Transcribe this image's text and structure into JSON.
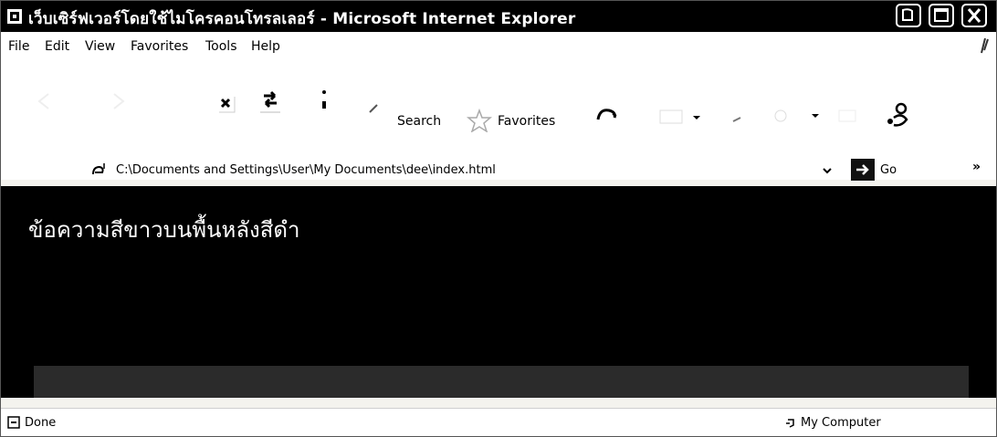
{
  "window": {
    "title": "เว็บเซิร์ฟเวอร์โดยใช้ไมโครคอนโทรลเลอร์ - Microsoft Internet Explorer"
  },
  "menubar": {
    "items": [
      "File",
      "Edit",
      "View",
      "Favorites",
      "Tools",
      "Help"
    ]
  },
  "toolbar": {
    "search_label": "Search",
    "favorites_label": "Favorites"
  },
  "address": {
    "url": "C:\\Documents and Settings\\User\\My Documents\\dee\\index.html",
    "go_label": "Go",
    "more_glyph": "»"
  },
  "content": {
    "text": "ข้อความสีขาวบนพื้นหลังสีดำ",
    "background": "#000000",
    "text_color": "#ffffff"
  },
  "statusbar": {
    "status": "Done",
    "zone": "My Computer"
  },
  "colors": {
    "titlebar": "#000000",
    "chrome": "#ffffff"
  },
  "icons": [
    "ie-icon",
    "minimize-icon",
    "maximize-icon",
    "close-icon",
    "throbber-icon",
    "back-icon",
    "forward-icon",
    "stop-icon",
    "refresh-icon",
    "home-icon",
    "search-icon",
    "favorites-icon",
    "history-icon",
    "mail-icon",
    "print-icon",
    "edit-icon",
    "messenger-icon",
    "page-icon",
    "go-icon",
    "done-icon",
    "my-computer-icon"
  ]
}
